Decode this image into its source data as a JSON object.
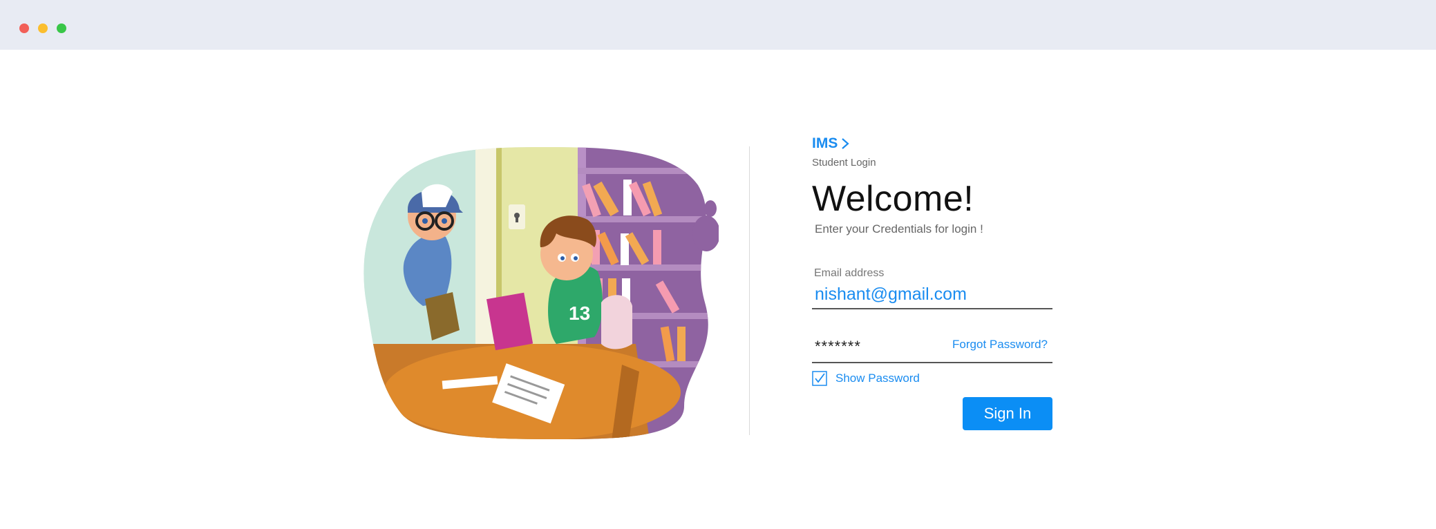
{
  "window": {
    "controls": [
      "close",
      "minimize",
      "maximize"
    ]
  },
  "brand": {
    "name": "IMS",
    "icon": "chevron-right-icon",
    "color": "#1a8cf0"
  },
  "login": {
    "subtitle": "Student Login",
    "heading": "Welcome!",
    "tagline": "Enter your Credentials for login !",
    "email_label": "Email address",
    "email_value": "nishant@gmail.com",
    "password_value": "*******",
    "forgot_label": "Forgot Password?",
    "show_password_label": "Show Password",
    "show_password_checked": true,
    "signin_label": "Sign In"
  },
  "illustration": {
    "icon": "students-illustration",
    "jersey_number": "13"
  },
  "colors": {
    "accent": "#0b8ef5",
    "titlebar": "#e8ebf3"
  }
}
